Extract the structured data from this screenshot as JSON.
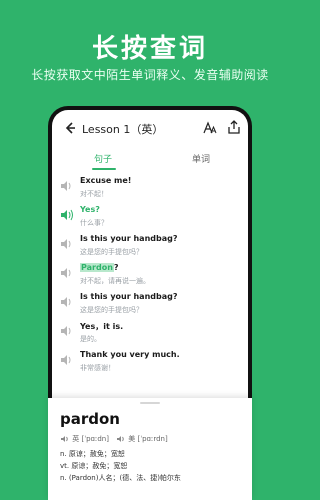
{
  "hero": {
    "title": "长按查词",
    "subtitle": "长按获取文中陌生单词释义、发音辅助阅读"
  },
  "app": {
    "lesson_title": "Lesson 1（英）",
    "tabs": {
      "sentences": "句子",
      "words": "单词"
    },
    "sentences": [
      {
        "en": "Excuse me!",
        "zh": "对不起！"
      },
      {
        "en": "Yes?",
        "zh": "什么事？"
      },
      {
        "en": "Is this your handbag?",
        "zh": "这是您的手提包吗？"
      },
      {
        "en_highlight": "Pardon",
        "en_rest": "?",
        "zh": "对不起，请再说一遍。"
      },
      {
        "en": "Is this your handbag?",
        "zh": "这是您的手提包吗？"
      },
      {
        "en": "Yes，it is.",
        "zh": "是的。"
      },
      {
        "en": "Thank you very much.",
        "zh": "非常感谢！"
      }
    ]
  },
  "dictionary": {
    "word": "pardon",
    "pron_uk": "英 [ˈpɑːdn]",
    "pron_us": "美 [ˈpɑːrdn]",
    "definitions": [
      "n. 原谅；赦免；宽恕",
      "vt. 原谅；赦免；宽恕",
      "n. (Pardon)人名；(德、法、捷)帕尔东"
    ]
  },
  "colors": {
    "accent": "#2fb36b"
  },
  "icons": [
    "back-arrow-icon",
    "font-size-icon",
    "share-icon",
    "speaker-icon"
  ]
}
